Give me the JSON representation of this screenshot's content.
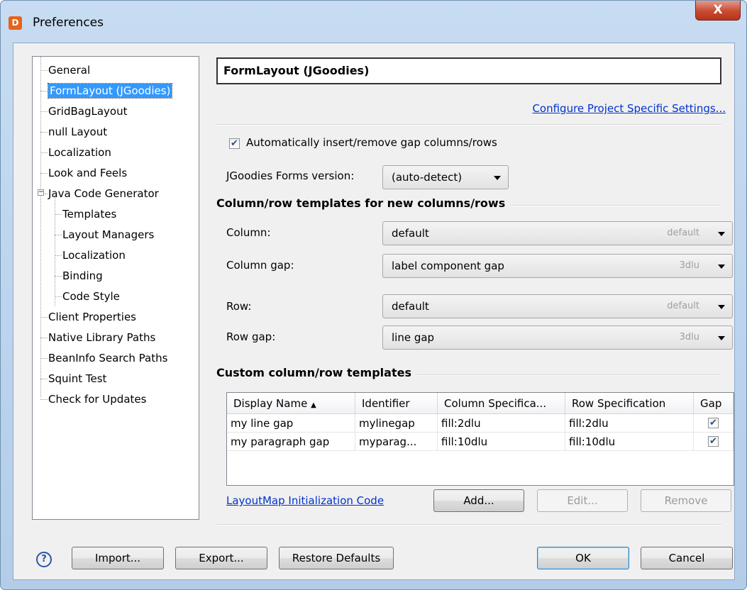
{
  "window": {
    "title": "Preferences",
    "close_label": "X",
    "app_icon": "jformdesigner-icon"
  },
  "tree": {
    "items": [
      {
        "label": "General"
      },
      {
        "label": "FormLayout (JGoodies)",
        "selected": true
      },
      {
        "label": "GridBagLayout"
      },
      {
        "label": "null Layout"
      },
      {
        "label": "Localization"
      },
      {
        "label": "Look and Feels"
      },
      {
        "label": "Java Code Generator",
        "expanded": true
      },
      {
        "label": "Templates"
      },
      {
        "label": "Layout Managers"
      },
      {
        "label": "Localization"
      },
      {
        "label": "Binding"
      },
      {
        "label": "Code Style"
      },
      {
        "label": "Client Properties"
      },
      {
        "label": "Native Library Paths"
      },
      {
        "label": "BeanInfo Search Paths"
      },
      {
        "label": "Squint Test"
      },
      {
        "label": "Check for Updates"
      }
    ]
  },
  "pane": {
    "title": "FormLayout (JGoodies)",
    "configure_link": "Configure Project Specific Settings...",
    "auto_gap": {
      "label": "Automatically insert/remove gap columns/rows",
      "checked": true
    },
    "forms_version": {
      "label": "JGoodies Forms version:",
      "value": "(auto-detect)"
    },
    "templates_section": "Column/row templates for new columns/rows",
    "column": {
      "label": "Column:",
      "value": "default",
      "hint": "default"
    },
    "column_gap": {
      "label": "Column gap:",
      "value": "label component gap",
      "hint": "3dlu"
    },
    "row": {
      "label": "Row:",
      "value": "default",
      "hint": "default"
    },
    "row_gap": {
      "label": "Row gap:",
      "value": "line gap",
      "hint": "3dlu"
    },
    "custom_section": "Custom column/row templates",
    "table": {
      "headers": [
        "Display Name",
        "Identifier",
        "Column Specifica...",
        "Row Specification",
        "Gap"
      ],
      "sort_indicator": "▲",
      "rows": [
        {
          "name": "my line gap",
          "id": "mylinegap",
          "col": "fill:2dlu",
          "row": "fill:2dlu",
          "gap": true
        },
        {
          "name": "my paragraph gap",
          "id": "myparag...",
          "col": "fill:10dlu",
          "row": "fill:10dlu",
          "gap": true
        }
      ]
    },
    "layoutmap_link": "LayoutMap Initialization Code",
    "add_button": "Add...",
    "edit_button": "Edit...",
    "remove_button": "Remove"
  },
  "footer": {
    "help_icon": "?",
    "import_button": "Import...",
    "export_button": "Export...",
    "restore_button": "Restore Defaults",
    "ok_button": "OK",
    "cancel_button": "Cancel"
  }
}
